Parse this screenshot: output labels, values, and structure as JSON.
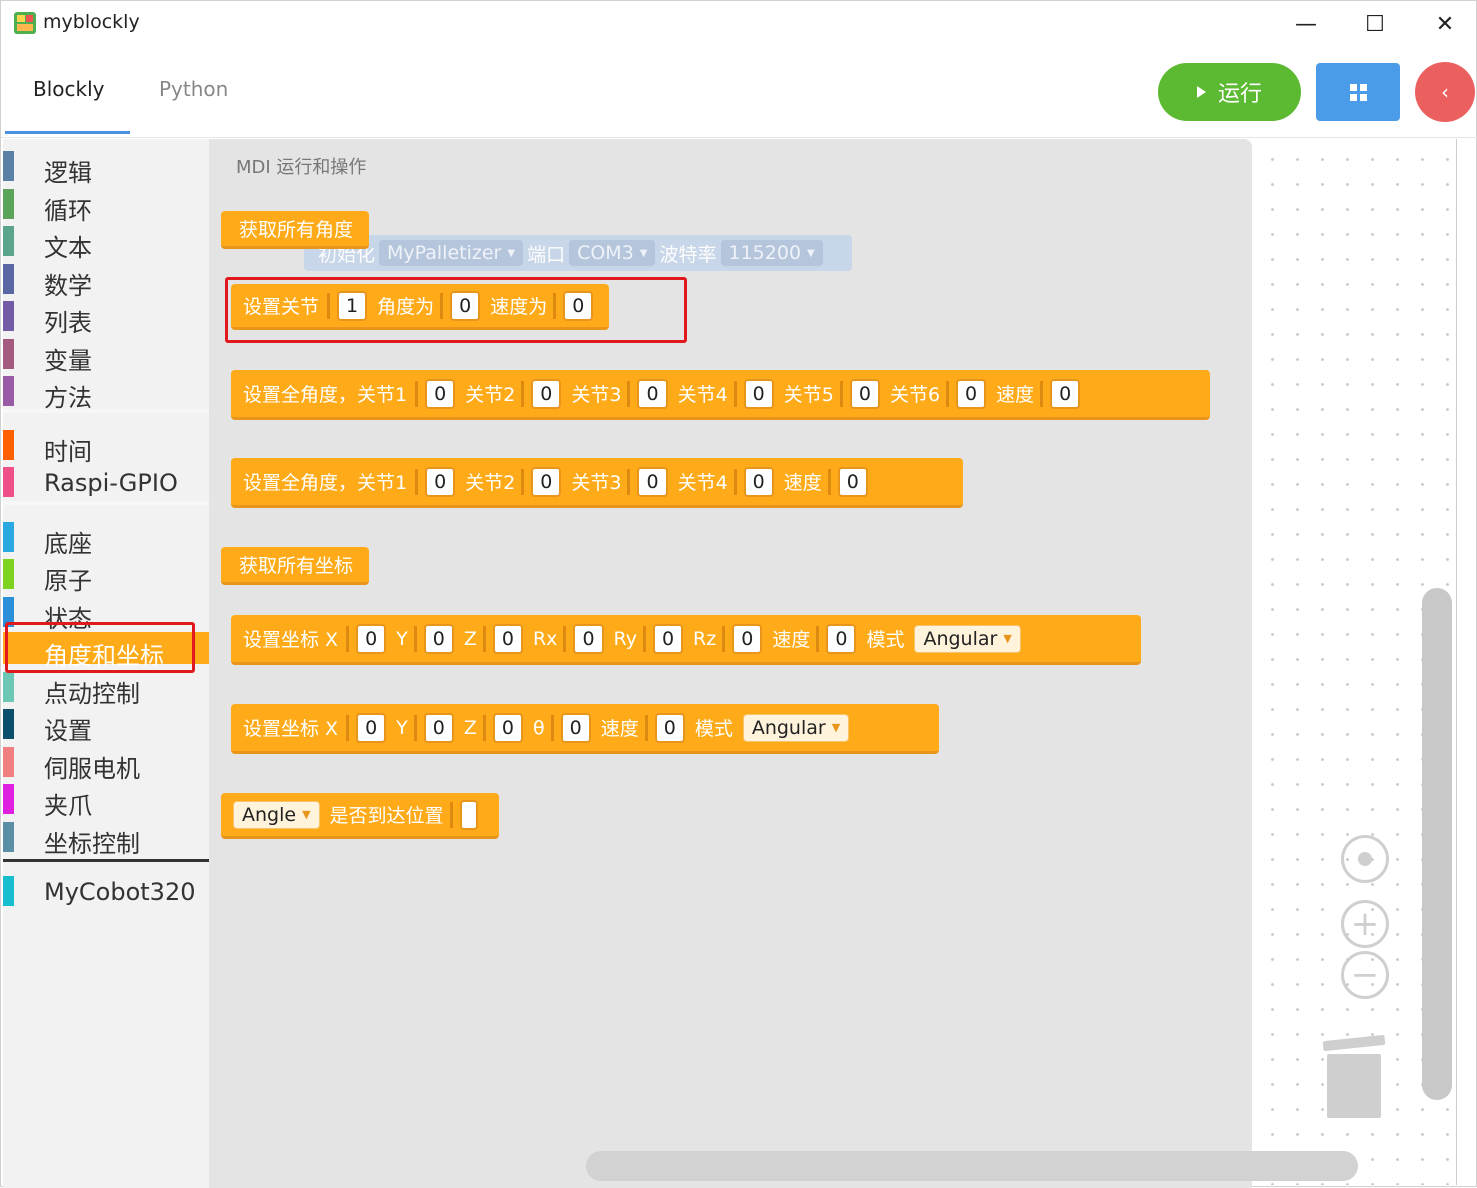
{
  "app": {
    "title": "myblockly"
  },
  "window_controls": {
    "minimize": "—",
    "maximize": "☐",
    "close": "✕"
  },
  "tabs": [
    {
      "label": "Blockly",
      "active": true
    },
    {
      "label": "Python",
      "active": false
    }
  ],
  "toolbar": {
    "run_label": "运行",
    "back_glyph": "‹"
  },
  "colors": {
    "run": "#5cb932",
    "grid": "#4a9be8",
    "back": "#ec5f5f",
    "block": "#ffab19",
    "highlight": "#e0191f"
  },
  "sidebar": {
    "categories": [
      {
        "label": "逻辑",
        "color": "#5b80a5"
      },
      {
        "label": "循环",
        "color": "#5ba55b"
      },
      {
        "label": "文本",
        "color": "#5ba58c"
      },
      {
        "label": "数学",
        "color": "#5b67a5"
      },
      {
        "label": "列表",
        "color": "#745ba5"
      },
      {
        "label": "变量",
        "color": "#a55b80"
      },
      {
        "label": "方法",
        "color": "#995ba5"
      },
      {
        "label": "时间",
        "color": "#ff6000"
      },
      {
        "label": "Raspi-GPIO",
        "color": "#f0508a"
      },
      {
        "label": "底座",
        "color": "#2aa8e0"
      },
      {
        "label": "原子",
        "color": "#7ed321"
      },
      {
        "label": "状态",
        "color": "#2b90d9"
      },
      {
        "label": "角度和坐标",
        "color": "#ffab19",
        "selected": true
      },
      {
        "label": "点动控制",
        "color": "#6cc7b5"
      },
      {
        "label": "设置",
        "color": "#0b4f6c"
      },
      {
        "label": "伺服电机",
        "color": "#f08080"
      },
      {
        "label": "夹爪",
        "color": "#e020e0"
      },
      {
        "label": "坐标控制",
        "color": "#5b8fa5"
      },
      {
        "label": "MyCobot320",
        "color": "#17becf"
      }
    ]
  },
  "flyout": {
    "section_label": "MDI 运行和操作",
    "ghost": {
      "label": "初始化",
      "device": "MyPalletizer",
      "port_label": "端口",
      "port": "COM3",
      "baud_label": "波特率",
      "baud": "115200"
    },
    "get_angles": "获取所有角度",
    "set_joint": {
      "label": "设置关节",
      "joint": "1",
      "angle_label": "角度为",
      "angle": "0",
      "speed_label": "速度为",
      "speed": "0"
    },
    "set_angles6": {
      "label": "设置全角度，关节1",
      "j1": "0",
      "j2_label": "关节2",
      "j2": "0",
      "j3_label": "关节3",
      "j3": "0",
      "j4_label": "关节4",
      "j4": "0",
      "j5_label": "关节5",
      "j5": "0",
      "j6_label": "关节6",
      "j6": "0",
      "speed_label": "速度",
      "speed": "0"
    },
    "set_angles4": {
      "label": "设置全角度，关节1",
      "j1": "0",
      "j2_label": "关节2",
      "j2": "0",
      "j3_label": "关节3",
      "j3": "0",
      "j4_label": "关节4",
      "j4": "0",
      "speed_label": "速度",
      "speed": "0"
    },
    "get_coords": "获取所有坐标",
    "set_coords6": {
      "label": "设置坐标 X",
      "x": "0",
      "y_label": "Y",
      "y": "0",
      "z_label": "Z",
      "z": "0",
      "rx_label": "Rx",
      "rx": "0",
      "ry_label": "Ry",
      "ry": "0",
      "rz_label": "Rz",
      "rz": "0",
      "speed_label": "速度",
      "speed": "0",
      "mode_label": "模式",
      "mode": "Angular"
    },
    "set_coords4": {
      "label": "设置坐标 X",
      "x": "0",
      "y_label": "Y",
      "y": "0",
      "z_label": "Z",
      "z": "0",
      "theta_label": "θ",
      "theta": "0",
      "speed_label": "速度",
      "speed": "0",
      "mode_label": "模式",
      "mode": "Angular"
    },
    "in_position": {
      "type": "Angle",
      "label": "是否到达位置"
    }
  },
  "workspace": {
    "zoom_in": "+",
    "zoom_out": "−"
  }
}
